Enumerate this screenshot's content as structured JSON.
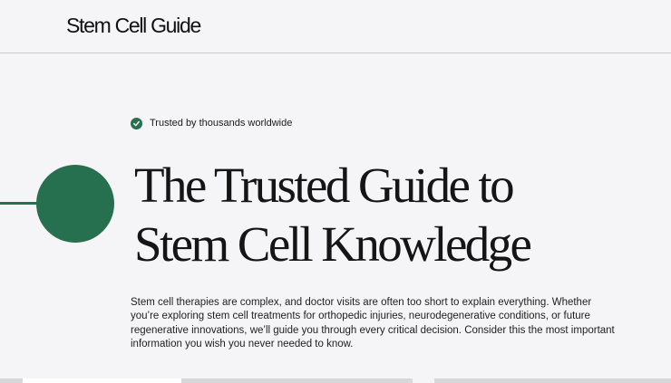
{
  "header": {
    "logo_text": "Stem Cell Guide"
  },
  "hero": {
    "trust_badge": {
      "icon": "check-circle-icon",
      "text": "Trusted by thousands worldwide"
    },
    "headline": {
      "line1": "The Trusted Guide to",
      "line2": "Stem Cell Knowledge"
    },
    "description": "Stem cell therapies are complex, and doctor visits are often too short to explain everything. Whether you’re exploring stem cell treatments for orthopedic injuries, neurodegenerative conditions, or future regenerative innovations, we’ll guide you through every critical decision. Consider this the most important information you wish you never needed to know."
  },
  "colors": {
    "accent_green": "#27704f",
    "background": "#f5f5f7",
    "text": "#151515"
  }
}
